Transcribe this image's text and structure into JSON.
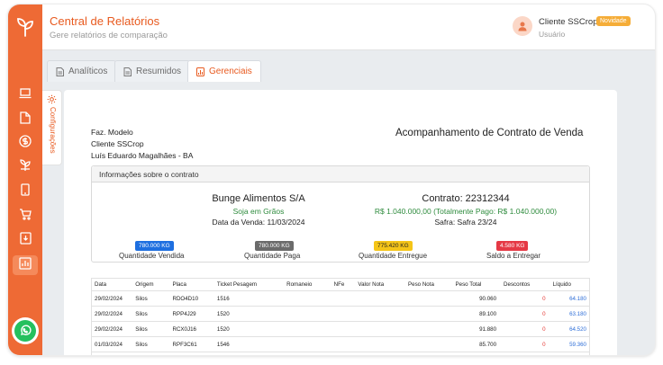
{
  "header": {
    "title": "Central de Relatórios",
    "subtitle": "Gere relatórios de comparação",
    "user_name": "Cliente SSCrop",
    "badge": "Novidade",
    "user_role": "Usuário"
  },
  "colors": {
    "brand": "#ee6a35",
    "accent_text": "#e85a1f",
    "green": "#2e8b3d",
    "blue_chip": "#1e6fe0",
    "gray_chip": "#6b6b6b",
    "yellow_chip": "#f5c518",
    "red_chip": "#e53945"
  },
  "tabs": [
    {
      "label": "Analíticos",
      "icon": "document-icon"
    },
    {
      "label": "Resumidos",
      "icon": "document-icon"
    },
    {
      "label": "Gerenciais",
      "icon": "bar-chart-icon"
    }
  ],
  "side_tab": {
    "label": "Configurações",
    "icon": "gear-icon"
  },
  "report": {
    "farm": "Faz. Modelo",
    "client": "Cliente SSCrop",
    "location": "Luís Eduardo Magalhães - BA",
    "title": "Acompanhamento de Contrato de Venda",
    "section_title": "Informações sobre o contrato",
    "buyer": "Bunge Alimentos S/A",
    "product": "Soja em Grãos",
    "sale_date": "Data da Venda: 11/03/2024",
    "contract": "Contrato: 22312344",
    "value": "R$ 1.040.000,00 (Totalmente Pago: R$ 1.040.000,00)",
    "harvest": "Safra: Safra 23/24"
  },
  "quantities": [
    {
      "chip": "780.000 KG",
      "label": "Quantidade Vendida"
    },
    {
      "chip": "780.000 KG",
      "label": "Quantidade Paga"
    },
    {
      "chip": "775.420 KG",
      "label": "Quantidade Entregue"
    },
    {
      "chip": "4.580 KG",
      "label": "Saldo a Entregar"
    }
  ],
  "table": {
    "headers": [
      "Data",
      "Origem",
      "Placa",
      "Ticket Pesagem",
      "Romaneio",
      "NFe",
      "Valor Nota",
      "Peso Nota",
      "Peso Total",
      "Descontos",
      "Líquido"
    ],
    "rows": [
      [
        "29/02/2024",
        "Silos",
        "RDO4D10",
        "1516",
        "",
        "",
        "",
        "",
        "90.060",
        "0",
        "64.180"
      ],
      [
        "29/02/2024",
        "Silos",
        "RPP4J29",
        "1520",
        "",
        "",
        "",
        "",
        "89.100",
        "0",
        "63.180"
      ],
      [
        "29/02/2024",
        "Silos",
        "RCX0J16",
        "1520",
        "",
        "",
        "",
        "",
        "91.880",
        "0",
        "64.520"
      ],
      [
        "01/03/2024",
        "Silos",
        "RPF3C61",
        "1546",
        "",
        "",
        "",
        "",
        "85.700",
        "0",
        "59.360"
      ]
    ]
  }
}
